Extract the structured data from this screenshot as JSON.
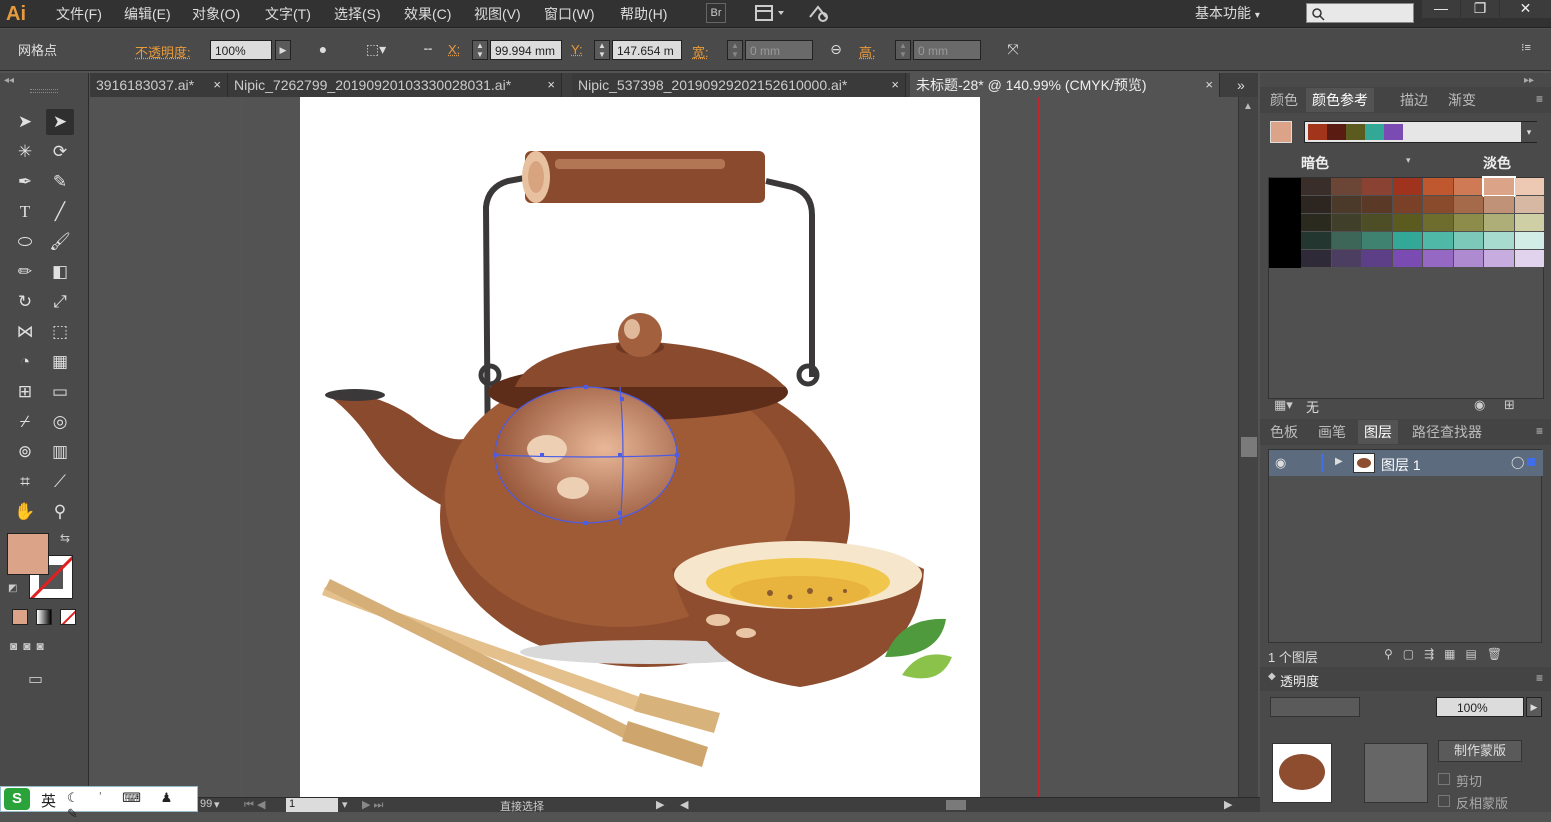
{
  "app": {
    "logo": "Ai"
  },
  "menu": [
    "文件(F)",
    "编辑(E)",
    "对象(O)",
    "文字(T)",
    "选择(S)",
    "效果(C)",
    "视图(V)",
    "窗口(W)",
    "帮助(H)"
  ],
  "top_right": {
    "bridge": "Br",
    "workspace": "基本功能",
    "win_min": "—",
    "win_max": "❐",
    "win_close": "✕"
  },
  "control_bar": {
    "mode_label": "网格点",
    "opacity_label": "不透明度:",
    "opacity_value": "100%",
    "x_label": "X:",
    "x_value": "99.994 mm",
    "y_label": "Y:",
    "y_value": "147.654 m",
    "w_label": "宽:",
    "w_value": "0 mm",
    "h_label": "高:",
    "h_value": "0 mm"
  },
  "doc_tabs": [
    {
      "label": "3916183037.ai*",
      "active": false
    },
    {
      "label": "Nipic_7262799_20190920103330028031.ai*",
      "active": false
    },
    {
      "label": "Nipic_537398_20190929202152610000.ai*",
      "active": false
    },
    {
      "label": "未标题-28* @ 140.99% (CMYK/预览)",
      "active": true
    }
  ],
  "tab_close": "×",
  "tab_overflow": "»",
  "color_panel": {
    "tabs": [
      "颜色",
      "颜色参考",
      "描边",
      "渐变"
    ],
    "dark_label": "暗色",
    "light_label": "淡色",
    "current_color": "#dba387",
    "harmony": [
      "#a2341c",
      "#5a1c12",
      "#5b5a1f",
      "#34a896",
      "#7a4bb3"
    ],
    "swatch_grid": [
      [
        "#3a2e2a",
        "#6b4536",
        "#8a4232",
        "#a0331e",
        "#c0582f",
        "#d07a55",
        "#dba387",
        "#edc8b3"
      ],
      [
        "#2c2520",
        "#4b3a2a",
        "#5a3a27",
        "#7a4028",
        "#8a4a2c",
        "#a56a4a",
        "#c09278",
        "#d6b8a3"
      ],
      [
        "#2a2a1e",
        "#40402a",
        "#4e4e26",
        "#5b5a1f",
        "#6e6d2e",
        "#8d8c4b",
        "#aeae78",
        "#cfcfa6"
      ],
      [
        "#243630",
        "#3e6658",
        "#3f8270",
        "#34a896",
        "#4fb8a7",
        "#7cc8b9",
        "#a8dbcf",
        "#d2ece6"
      ],
      [
        "#2e2a38",
        "#4c3e60",
        "#5c3f86",
        "#7a4bb3",
        "#9569c3",
        "#ae8ad0",
        "#c7addf",
        "#e1d3ee"
      ]
    ],
    "none_label": "无"
  },
  "layers_panel": {
    "tabs": [
      "色板",
      "画笔",
      "图层",
      "路径查找器"
    ],
    "layer_name": "图层 1",
    "layer_count": "1 个图层"
  },
  "transparency_panel": {
    "label": "透明度",
    "opacity_value": "100%",
    "make_mask": "制作蒙版",
    "clip": "剪切",
    "invert_mask": "反相蒙版"
  },
  "status": {
    "zoom": "99",
    "page": "1",
    "tool_name": "直接选择"
  },
  "ime": {
    "label": "英"
  },
  "colors": {
    "fill": "#dba387",
    "accent": "#e89b3c",
    "guide": "#c2262e",
    "selection": "#4a5ce8"
  }
}
